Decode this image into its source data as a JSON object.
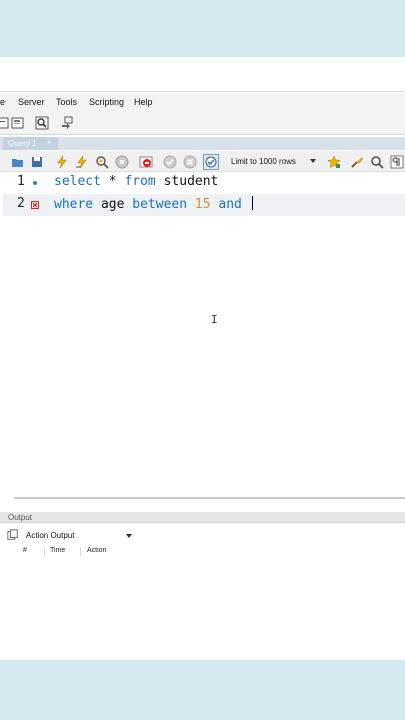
{
  "menu": {
    "items": [
      "e",
      "Server",
      "Tools",
      "Scripting",
      "Help"
    ]
  },
  "toolbar_top": {
    "icons": [
      "new-sql-tab-icon",
      "open-sql-icon",
      "inspector-icon",
      "migration-icon"
    ]
  },
  "tabs": [
    {
      "label": "Query 1",
      "close": "×"
    }
  ],
  "sql_toolbar": {
    "limit_label": "Limit to 1000 rows",
    "icons": [
      "open-file-icon",
      "save-icon",
      "execute-icon",
      "execute-current-icon",
      "explain-icon",
      "stop-icon",
      "toggle-error-icon",
      "commit-icon",
      "rollback-icon",
      "autocommit-icon",
      "bookmark-icon",
      "beautify-icon",
      "find-icon",
      "invisible-chars-icon"
    ]
  },
  "editor": {
    "lines": [
      {
        "number": "1",
        "marker": "dot",
        "tokens": [
          {
            "t": "select",
            "kw": true
          },
          {
            "t": " * ",
            "kw": false
          },
          {
            "t": "from",
            "kw": true
          },
          {
            "t": " student",
            "kw": false
          }
        ]
      },
      {
        "number": "2",
        "marker": "error",
        "tokens": [
          {
            "t": "where",
            "kw": true
          },
          {
            "t": " age ",
            "kw": false
          },
          {
            "t": "between",
            "kw": true
          },
          {
            "t": " ",
            "kw": false
          },
          {
            "t": "15",
            "num": true
          },
          {
            "t": " ",
            "kw": false
          },
          {
            "t": "and",
            "kw": true
          },
          {
            "t": " ",
            "kw": false
          }
        ]
      }
    ],
    "cursor_glyph": "I"
  },
  "output": {
    "panel_title": "Output",
    "selector_value": "Action Output",
    "columns": [
      "#",
      "Time",
      "Action"
    ]
  },
  "colors": {
    "keyword": "#1a6fc0",
    "number": "#e08a2c",
    "background": "#d6e9ef"
  }
}
